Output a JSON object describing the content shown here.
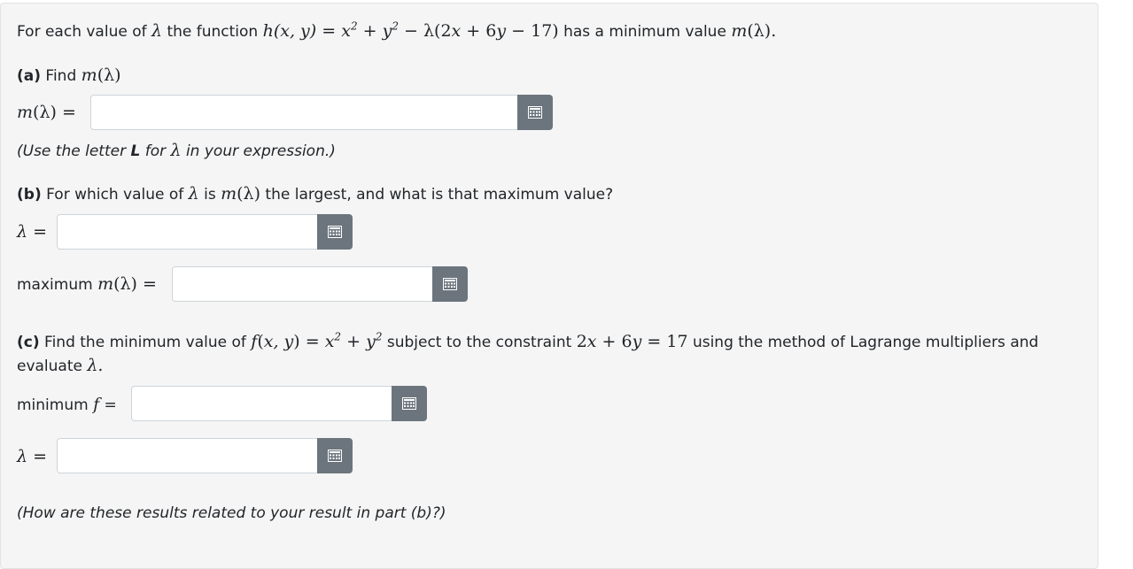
{
  "intro": {
    "prefix": "For each value of",
    "lambda": "λ",
    "middle": "the function",
    "expr": "h(x, y) = x² + y² − λ(2x + 6y − 17)",
    "suffix": "has a minimum value",
    "m_expr": "m(λ)."
  },
  "part_a": {
    "tag": "(a)",
    "text": "Find",
    "m_expr": "m(λ)",
    "field_label": "m(λ) =",
    "hint_prefix": "(Use the letter",
    "hint_letter": "L",
    "hint_mid": "for",
    "hint_lambda": "λ",
    "hint_suffix": "in your expression.)"
  },
  "part_b": {
    "tag": "(b)",
    "text_prefix": "For which value of",
    "lambda": "λ",
    "text_is": "is",
    "m_expr": "m(λ)",
    "text_suffix": "the largest, and what is that maximum value?",
    "lambda_label": "λ =",
    "max_label_text": "maximum",
    "max_label_math": "m(λ) ="
  },
  "part_c": {
    "tag": "(c)",
    "text_prefix": "Find the minimum value of",
    "f_expr": "f(x, y) = x² + y²",
    "text_mid": "subject to the constraint",
    "constraint": "2x + 6y = 17",
    "text_suffix": "using the method of Lagrange multipliers and",
    "line2_prefix": "evaluate",
    "line2_lambda": "λ.",
    "min_label_text": "minimum",
    "min_label_math": "f",
    "min_label_eq": "=",
    "lambda_label": "λ ="
  },
  "footer_note": "(How are these results related to your result in part (b)?)",
  "inputs": {
    "m_lambda": "",
    "lambda_b": "",
    "max_m": "",
    "min_f": "",
    "lambda_c": ""
  },
  "colors": {
    "keypad_button": "#6c757d",
    "card_background": "#f5f5f5"
  },
  "icons": {
    "keypad": "keypad-icon"
  }
}
